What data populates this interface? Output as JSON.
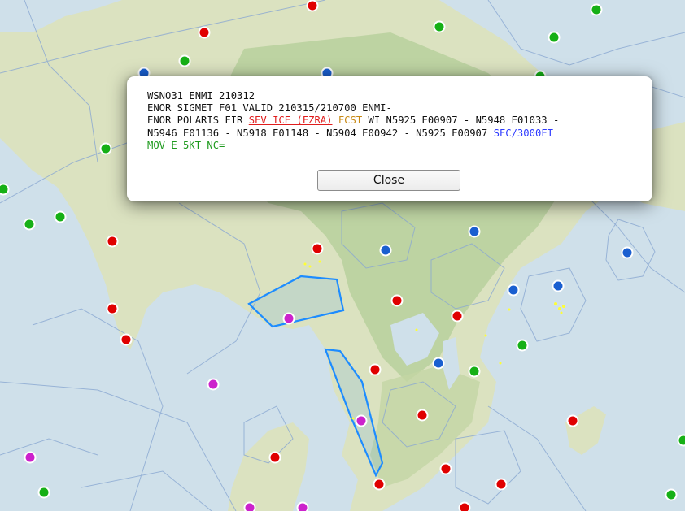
{
  "popup": {
    "line1": "WSNO31 ENMI 210312",
    "line2": "ENOR SIGMET F01 VALID 210315/210700 ENMI-",
    "line3_prefix": "ENOR POLARIS FIR ",
    "line3_hazard": "SEV ICE (FZRA)",
    "line3_fcst": " FCST",
    "line3_rest": " WI N5925 E00907 - N5948 E01033 -",
    "line4_coords": "N5946 E01136 - N5918 E01148 - N5904 E00942 - N5925 E00907 ",
    "line4_alt": "SFC/3000FT",
    "line5": "MOV E 5KT NC=",
    "close_label": "Close"
  },
  "colors": {
    "sea": "#cfe0ea",
    "land": "#dbe2c0",
    "forest": "#b5cf9a",
    "fir_boundary": "#8aa8d2",
    "sigmet_polygon": "#1d8cff",
    "station_red": "#e00000",
    "station_blue": "#1a5fd0",
    "station_green": "#16b016",
    "station_magenta": "#cc22cc"
  }
}
